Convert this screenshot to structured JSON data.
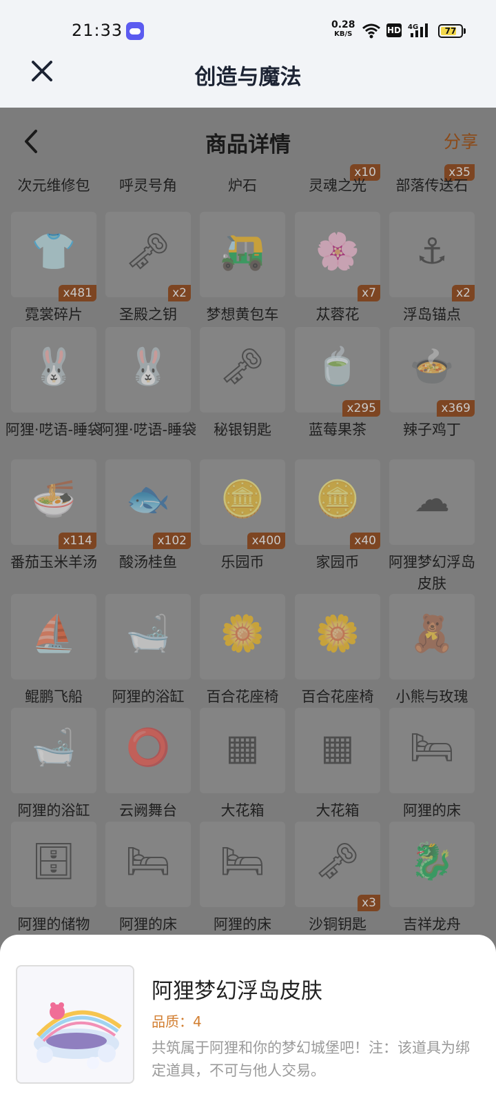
{
  "status_bar": {
    "time": "21:33",
    "net_speed_value": "0.28",
    "net_speed_unit": "KB/S",
    "hd_label": "HD",
    "signal_label": "4G",
    "battery_level": "77"
  },
  "app_bar": {
    "title": "创造与魔法",
    "close_icon": "close-icon"
  },
  "detail_header": {
    "title": "商品详情",
    "share_label": "分享",
    "back_icon": "chevron-left-icon"
  },
  "top_row": [
    {
      "name": "次元维修包",
      "count": ""
    },
    {
      "name": "呼灵号角",
      "count": ""
    },
    {
      "name": "炉石",
      "count": ""
    },
    {
      "name": "灵魂之光",
      "count": "x10"
    },
    {
      "name": "部落传送石",
      "count": "x35"
    }
  ],
  "items": [
    {
      "name": "霓裳碎片",
      "count": "x481",
      "icon": "shirt-icon"
    },
    {
      "name": "圣殿之钥",
      "count": "x2",
      "icon": "key-icon"
    },
    {
      "name": "梦想黄包车",
      "count": "",
      "icon": "rickshaw-icon"
    },
    {
      "name": "苁蓉花",
      "count": "x7",
      "icon": "flower-icon"
    },
    {
      "name": "浮岛锚点",
      "count": "x2",
      "icon": "anchor-icon"
    },
    {
      "name": "阿狸·呓语-睡袋",
      "count": "",
      "icon": "sleeping-bag-icon"
    },
    {
      "name": "阿狸·呓语-睡袋",
      "count": "",
      "icon": "sleeping-bag-icon"
    },
    {
      "name": "秘银钥匙",
      "count": "",
      "icon": "key-icon"
    },
    {
      "name": "蓝莓果茶",
      "count": "x295",
      "icon": "tea-bowl-icon"
    },
    {
      "name": "辣子鸡丁",
      "count": "x369",
      "icon": "dish-icon"
    },
    {
      "name": "番茄玉米羊汤",
      "count": "x114",
      "icon": "soup-icon"
    },
    {
      "name": "酸汤桂鱼",
      "count": "x102",
      "icon": "fish-dish-icon"
    },
    {
      "name": "乐园币",
      "count": "x400",
      "icon": "coin-icon"
    },
    {
      "name": "家园币",
      "count": "x40",
      "icon": "coin-icon"
    },
    {
      "name": "阿狸梦幻浮岛皮肤",
      "count": "",
      "icon": "island-icon"
    },
    {
      "name": "鲲鹏飞船",
      "count": "",
      "icon": "airship-icon"
    },
    {
      "name": "阿狸的浴缸",
      "count": "",
      "icon": "bathtub-icon"
    },
    {
      "name": "百合花座椅",
      "count": "",
      "icon": "lily-chair-icon"
    },
    {
      "name": "百合花座椅",
      "count": "",
      "icon": "lily-chair-icon"
    },
    {
      "name": "小熊与玫瑰",
      "count": "",
      "icon": "bear-icon"
    },
    {
      "name": "阿狸的浴缸",
      "count": "",
      "icon": "bathtub-icon"
    },
    {
      "name": "云阙舞台",
      "count": "",
      "icon": "stage-icon"
    },
    {
      "name": "大花箱",
      "count": "",
      "icon": "fence-icon"
    },
    {
      "name": "大花箱",
      "count": "",
      "icon": "fence-icon"
    },
    {
      "name": "阿狸的床",
      "count": "",
      "icon": "bed-icon"
    },
    {
      "name": "阿狸的储物",
      "count": "",
      "icon": "cabinet-icon"
    },
    {
      "name": "阿狸的床",
      "count": "",
      "icon": "bed-icon"
    },
    {
      "name": "阿狸的床",
      "count": "",
      "icon": "bed-icon"
    },
    {
      "name": "沙铜钥匙",
      "count": "x3",
      "icon": "key-icon"
    },
    {
      "name": "吉祥龙舟",
      "count": "",
      "icon": "dragon-boat-icon"
    }
  ],
  "bottom_sheet": {
    "name": "阿狸梦幻浮岛皮肤",
    "quality": "品质：4",
    "description": "共筑属于阿狸和你的梦幻城堡吧！注：该道具为绑定道具，不可与他人交易。",
    "icon": "island-icon"
  },
  "colors": {
    "accent": "#d27e30",
    "badge": "#c4622b",
    "scrim": "#7c7c7c"
  }
}
